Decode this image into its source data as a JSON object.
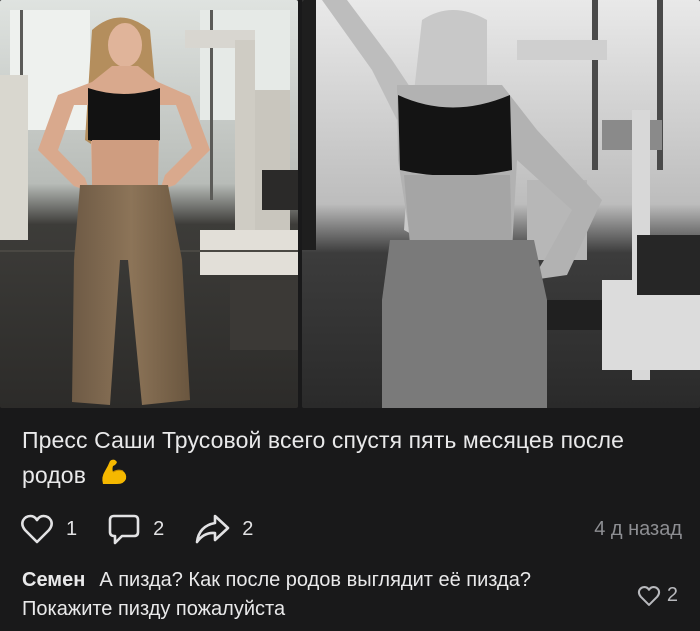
{
  "post": {
    "caption": "Пресс Саши Трусовой всего спустя пять месяцев после родов",
    "caption_emoji": "flexed-biceps-icon",
    "likes": "1",
    "comments": "2",
    "shares": "2",
    "time_ago": "4 д назад"
  },
  "comment": {
    "author": "Семен",
    "text": "А пизда? Как после родов выглядит её пизда? Покажите пизду пожалуйста",
    "likes": "2"
  },
  "icons": {
    "like": "heart-icon",
    "comment": "comment-bubble-icon",
    "share": "share-arrow-icon",
    "comment_like": "heart-icon"
  },
  "colors": {
    "background": "#19191a",
    "text": "#e9e9ea",
    "muted": "#8d8e92",
    "emoji": "#f5b800"
  }
}
